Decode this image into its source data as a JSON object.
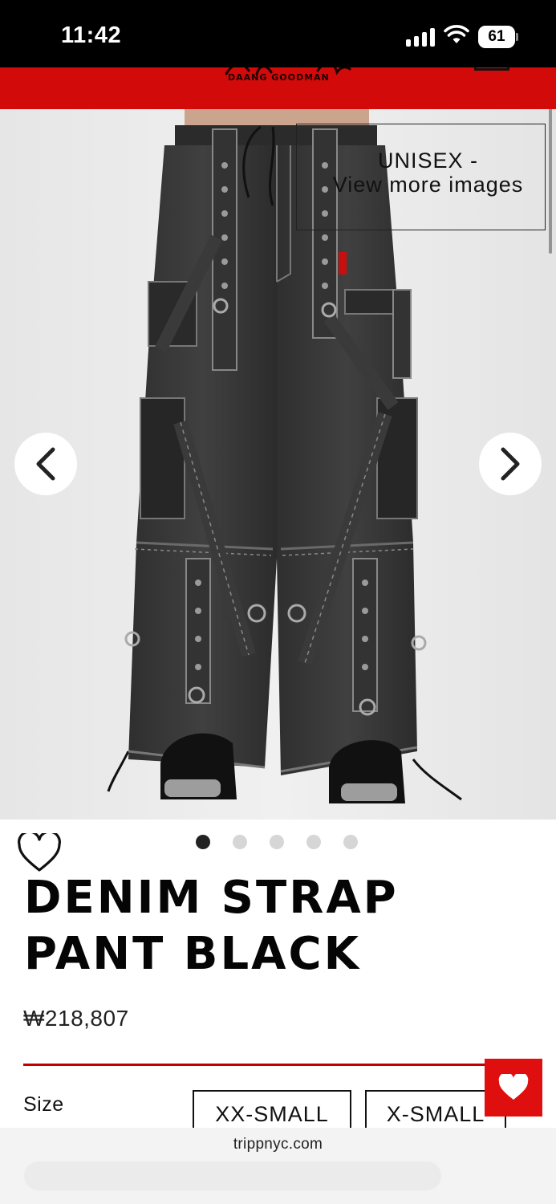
{
  "status_bar": {
    "time": "11:42",
    "battery": "61",
    "icons": [
      "signal-icon",
      "wifi-icon",
      "battery-icon"
    ]
  },
  "header": {
    "logo_text": "DAANG GOODMAN",
    "brand_color": "#d20a0a"
  },
  "gallery": {
    "overlay_text": "UNISEX -\nView more images",
    "prev_icon": "chevron-left-icon",
    "next_icon": "chevron-right-icon",
    "slides_total": 5,
    "active_slide": 1
  },
  "product": {
    "title": "DENIM STRAP PANT BLACK",
    "price": "₩218,807",
    "size_label": "Size",
    "sizes": [
      "XX-SMALL",
      "X-SMALL"
    ],
    "wishlist_icon": "heart-outline-icon",
    "accent_color": "#c10000"
  },
  "fab": {
    "icon": "heart-icon",
    "color": "#df0f0f"
  },
  "browser": {
    "url": "trippnyc.com"
  }
}
